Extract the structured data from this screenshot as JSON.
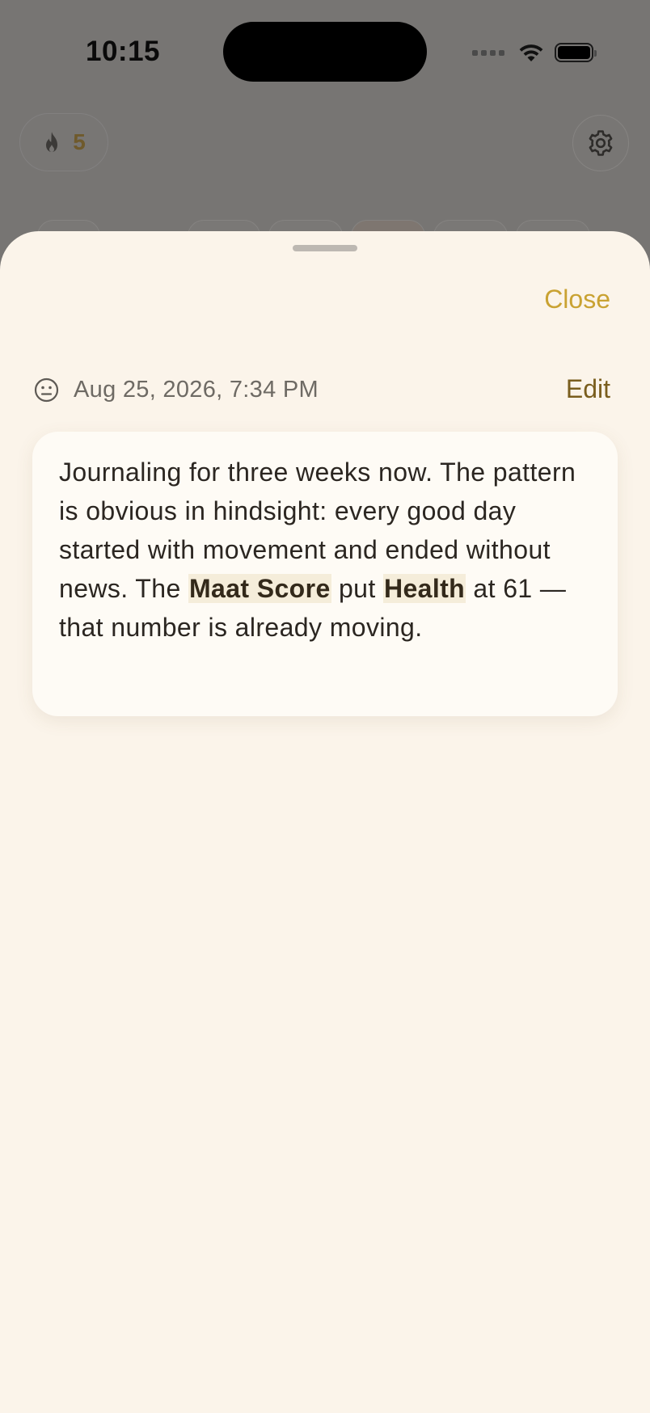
{
  "status_bar": {
    "time": "10:15"
  },
  "background": {
    "streak_count": "5",
    "chips": [
      "",
      "",
      "",
      "",
      "",
      "",
      ""
    ]
  },
  "sheet": {
    "close_label": "Close",
    "edit_label": "Edit",
    "entry": {
      "date": "Aug 25, 2026, 7:34 PM",
      "mood_icon": "neutral-face-icon",
      "text_parts": [
        "Journaling for three weeks now. The pattern is obvious in hindsight: every good day started with movement and ended without news. The ",
        "Maat Score",
        " put ",
        "Health",
        " at 61 — that number is already moving."
      ]
    }
  },
  "colors": {
    "accent_gold": "#c9a232",
    "edit_brown": "#7a5e1e",
    "sheet_bg": "#fbf4ea",
    "card_bg": "#fefbf5",
    "highlight_bg": "#f5edda"
  }
}
